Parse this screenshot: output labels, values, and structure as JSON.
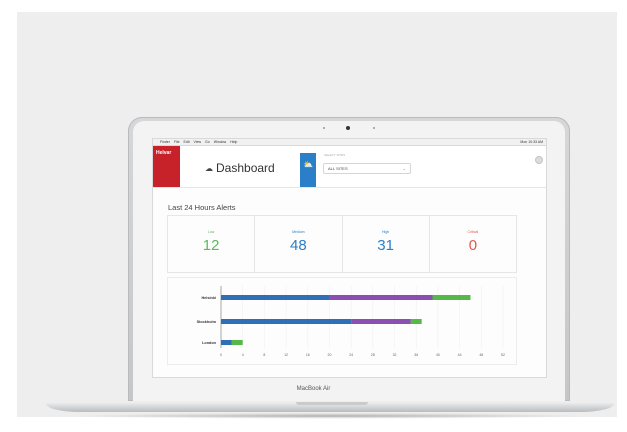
{
  "menubar": {
    "apple": "",
    "items": [
      "Finder",
      "File",
      "Edit",
      "View",
      "Go",
      "Window",
      "Help"
    ],
    "status": "Mon 10:33 AM"
  },
  "app": {
    "brand": "Helvar",
    "title": "Dashboard",
    "site_label": "SELECT SITES",
    "site_value": "ALL SITES"
  },
  "alerts": {
    "title": "Last 24 Hours Alerts",
    "cards": [
      {
        "label": "Low",
        "value": "12",
        "color": "#5cb85c"
      },
      {
        "label": "Medium",
        "value": "48",
        "color": "#2a7fc8"
      },
      {
        "label": "High",
        "value": "31",
        "color": "#2a7fc8"
      },
      {
        "label": "Critical",
        "value": "0",
        "color": "#e2574c"
      }
    ]
  },
  "chart_data": {
    "type": "bar",
    "orientation": "horizontal",
    "stacked": true,
    "categories": [
      "Helsinki",
      "Stockholm",
      "London"
    ],
    "series": [
      {
        "color": "#2f6fb8",
        "values": [
          20,
          24,
          2
        ]
      },
      {
        "color": "#8a4fb0",
        "values": [
          19,
          11,
          0
        ]
      },
      {
        "color": "#55b848",
        "values": [
          7,
          2,
          2
        ]
      }
    ],
    "xticks": [
      "0",
      "4",
      "8",
      "12",
      "16",
      "20",
      "24",
      "28",
      "32",
      "36",
      "40",
      "44",
      "48",
      "52"
    ],
    "xlim": [
      0,
      52
    ]
  },
  "device": {
    "label": "MacBook Air"
  }
}
